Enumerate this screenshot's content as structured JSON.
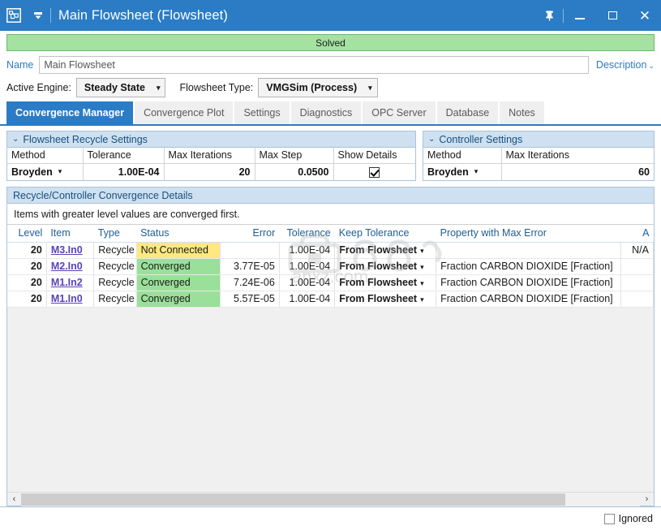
{
  "titlebar": {
    "app_icon": "flowsheet-icon",
    "quick_access_icon": "quick-access-dropdown-icon",
    "title": "Main Flowsheet (Flowsheet)",
    "pin_icon": "pin-icon",
    "minimize_icon": "minimize-icon",
    "maximize_icon": "maximize-icon",
    "close_icon": "close-icon",
    "accent_color": "#2b7cc4"
  },
  "status_banner": {
    "text": "Solved",
    "bg_color": "#a3e2a0",
    "border_color": "#6cba6a"
  },
  "name_row": {
    "label": "Name",
    "value": "Main Flowsheet",
    "placeholder": "Main Flowsheet",
    "description_link": "Description",
    "description_caret": "⌄"
  },
  "engine_row": {
    "active_engine_label": "Active Engine:",
    "active_engine_value": "Steady State",
    "flowsheet_type_label": "Flowsheet Type:",
    "flowsheet_type_value": "VMGSim (Process)",
    "caret": "▾"
  },
  "tabs": [
    {
      "label": "Convergence Manager",
      "active": true
    },
    {
      "label": "Convergence Plot",
      "active": false
    },
    {
      "label": "Settings",
      "active": false
    },
    {
      "label": "Diagnostics",
      "active": false
    },
    {
      "label": "OPC Server",
      "active": false
    },
    {
      "label": "Database",
      "active": false
    },
    {
      "label": "Notes",
      "active": false
    }
  ],
  "recycle_settings": {
    "panel_title": "Flowsheet Recycle Settings",
    "chevron": "⌄",
    "headers": [
      "Method",
      "Tolerance",
      "Max Iterations",
      "Max Step",
      "Show Details"
    ],
    "method": "Broyden",
    "tolerance": "1.00E-04",
    "max_iterations": "20",
    "max_step": "0.0500",
    "show_details_checked": true
  },
  "controller_settings": {
    "panel_title": "Controller Settings",
    "chevron": "⌄",
    "headers": [
      "Method",
      "Max Iterations"
    ],
    "method": "Broyden",
    "max_iterations": "60"
  },
  "details": {
    "panel_title": "Recycle/Controller Convergence Details",
    "hint": "Items with greater level values are converged first.",
    "columns": [
      "Level",
      "Item",
      "Type",
      "Status",
      "Error",
      "Tolerance",
      "Keep Tolerance",
      "Property with Max Error",
      "A"
    ],
    "rows": [
      {
        "level": "20",
        "item": "M3.In0",
        "type": "Recycle",
        "status": "Not Connected",
        "status_state": "not-connected",
        "error": "",
        "tolerance": "1.00E-04",
        "keep_tolerance": "From Flowsheet",
        "property": "",
        "last": "N/A"
      },
      {
        "level": "20",
        "item": "M2.In0",
        "type": "Recycle",
        "status": "Converged",
        "status_state": "converged",
        "error": "3.77E-05",
        "tolerance": "1.00E-04",
        "keep_tolerance": "From Flowsheet",
        "property": "Fraction CARBON DIOXIDE [Fraction]",
        "last": ""
      },
      {
        "level": "20",
        "item": "M1.In2",
        "type": "Recycle",
        "status": "Converged",
        "status_state": "converged",
        "error": "7.24E-06",
        "tolerance": "1.00E-04",
        "keep_tolerance": "From Flowsheet",
        "property": "Fraction CARBON DIOXIDE [Fraction]",
        "last": ""
      },
      {
        "level": "20",
        "item": "M1.In0",
        "type": "Recycle",
        "status": "Converged",
        "status_state": "converged",
        "error": "5.57E-05",
        "tolerance": "1.00E-04",
        "keep_tolerance": "From Flowsheet",
        "property": "Fraction CARBON DIOXIDE [Fraction]",
        "last": ""
      }
    ],
    "dropdown_caret": "▾",
    "status_colors": {
      "not_connected": "#ffe97f",
      "converged": "#9ae09a"
    },
    "link_color": "#5a42b8"
  },
  "hscrollbar": {
    "left_arrow": "‹",
    "right_arrow": "›",
    "thumb_percent": "88"
  },
  "bottom_bar": {
    "ignored_label": "Ignored",
    "ignored_checked": false
  },
  "watermark": {
    "text": "anxz.com"
  }
}
